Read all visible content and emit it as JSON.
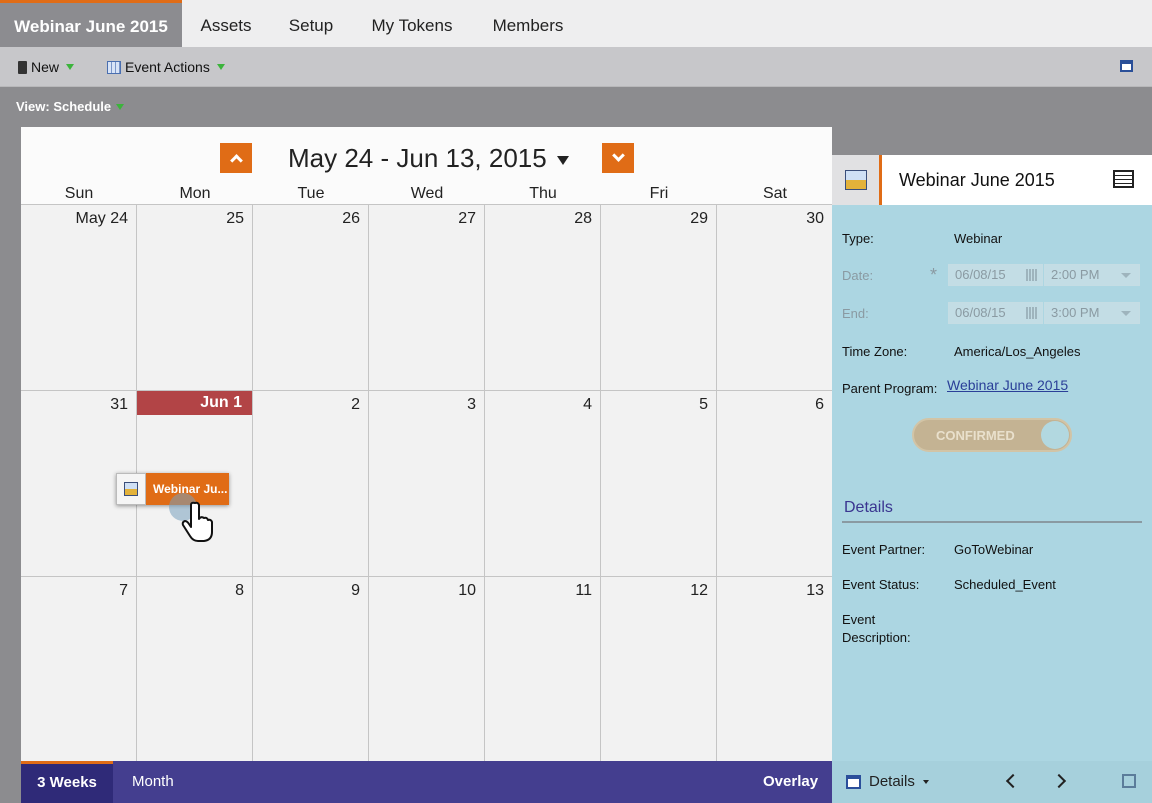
{
  "tabs": [
    {
      "label": "Webinar June 2015",
      "active": true
    },
    {
      "label": "Assets"
    },
    {
      "label": "Setup"
    },
    {
      "label": "My Tokens"
    },
    {
      "label": "Members"
    }
  ],
  "toolbar": {
    "new_label": "New",
    "event_actions_label": "Event Actions"
  },
  "view": {
    "label": "View: Schedule"
  },
  "calendar": {
    "range": "May 24 - Jun 13, 2015",
    "days_of_week": [
      "Sun",
      "Mon",
      "Tue",
      "Wed",
      "Thu",
      "Fri",
      "Sat"
    ],
    "weeks": [
      [
        "May 24",
        "25",
        "26",
        "27",
        "28",
        "29",
        "30"
      ],
      [
        "31",
        "Jun 1",
        "2",
        "3",
        "4",
        "5",
        "6"
      ],
      [
        "7",
        "8",
        "9",
        "10",
        "11",
        "12",
        "13"
      ]
    ],
    "today": "Jun 1",
    "event": {
      "label": "Webinar Ju...",
      "day": "8"
    }
  },
  "bottom_bar": {
    "three_weeks": "3 Weeks",
    "month": "Month",
    "overlay": "Overlay"
  },
  "detail": {
    "title": "Webinar June 2015",
    "type_label": "Type:",
    "type_value": "Webinar",
    "date_label": "Date:",
    "date_value": "06/08/15",
    "date_time": "2:00 PM",
    "end_label": "End:",
    "end_value": "06/08/15",
    "end_time": "3:00 PM",
    "tz_label": "Time Zone:",
    "tz_value": "America/Los_Angeles",
    "parent_label": "Parent Program:",
    "parent_value": "Webinar June 2015",
    "status_toggle": "CONFIRMED",
    "details_heading": "Details",
    "partner_label": "Event Partner:",
    "partner_value": "GoToWebinar",
    "status_label": "Event Status:",
    "status_value": "Scheduled_Event",
    "desc_label_1": "Event",
    "desc_label_2": "Description:",
    "required_mark": "*"
  },
  "detail_footer": {
    "dropdown_label": "Details"
  }
}
